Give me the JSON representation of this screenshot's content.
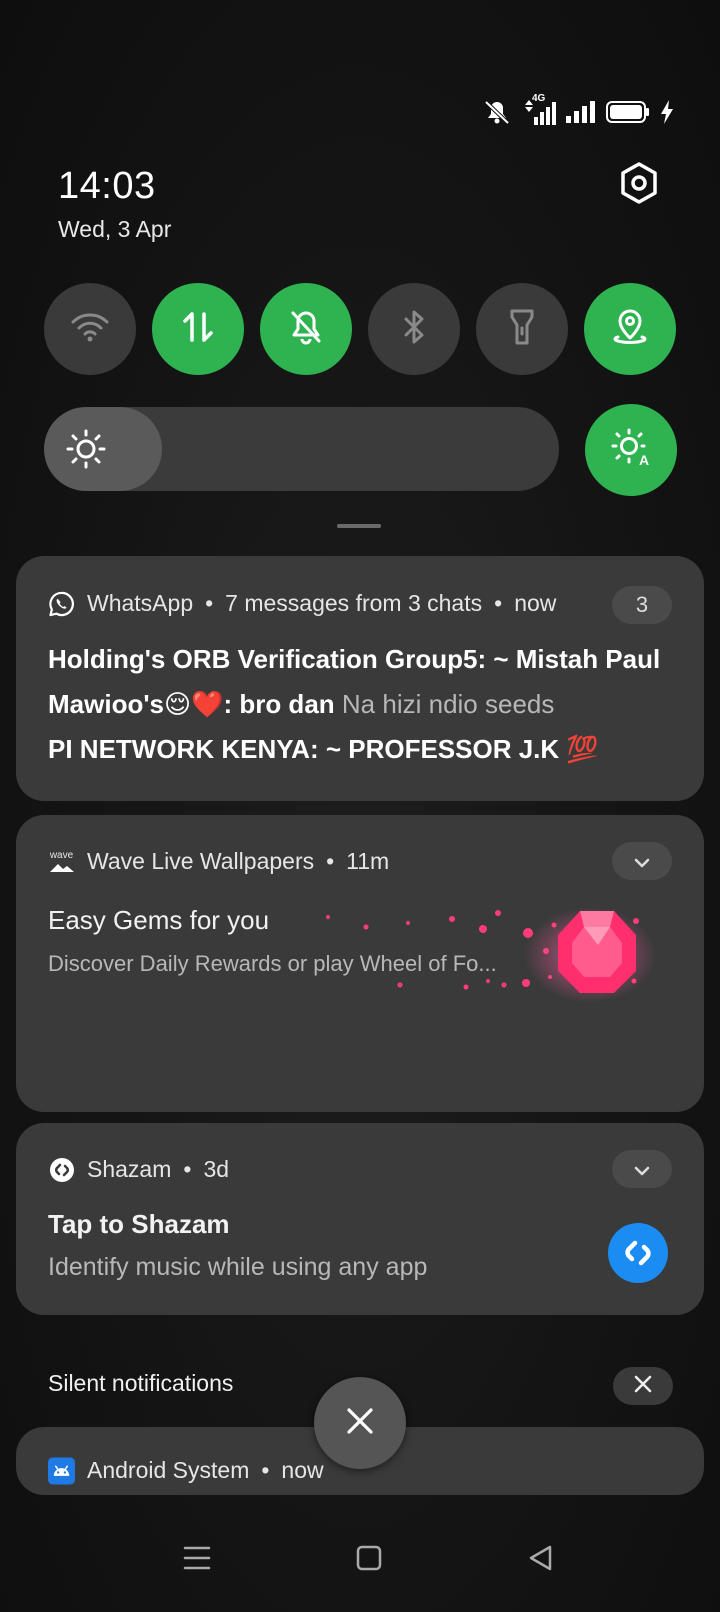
{
  "status_bar": {
    "network_label": "4G",
    "icons": [
      "mute-icon",
      "data-arrows-icon",
      "signal-icon",
      "signal-icon",
      "battery-icon",
      "charging-icon"
    ]
  },
  "header": {
    "time": "14:03",
    "date": "Wed, 3 Apr"
  },
  "quick_tiles": [
    {
      "name": "wifi",
      "state": "off"
    },
    {
      "name": "mobile-data",
      "state": "on"
    },
    {
      "name": "mute",
      "state": "on"
    },
    {
      "name": "bluetooth",
      "state": "off"
    },
    {
      "name": "flashlight",
      "state": "off"
    },
    {
      "name": "location",
      "state": "on"
    }
  ],
  "brightness": {
    "level": 0.23,
    "auto": true
  },
  "notifications": {
    "whatsapp": {
      "app": "WhatsApp",
      "sep1": "•",
      "summary": "7 messages from 3 chats",
      "sep2": "•",
      "time": "now",
      "count": "3",
      "lines": [
        {
          "sender": "Holding's ORB Verification Group5: ~ Mistah Paul",
          "text": ""
        },
        {
          "sender": "Mawioo's😌❤️: bro dan",
          "text": "Na hizi ndio seeds"
        },
        {
          "sender": "PI NETWORK KENYA: ~ PROFESSOR J.K",
          "text": "💯"
        }
      ]
    },
    "wave": {
      "icon_text": "wave",
      "app": "Wave Live Wallpapers",
      "sep": "•",
      "time": "11m",
      "title": "Easy Gems for you",
      "body": "Discover Daily Rewards or play Wheel of Fo..."
    },
    "shazam": {
      "app": "Shazam",
      "sep": "•",
      "time": "3d",
      "title": "Tap to Shazam",
      "body": "Identify music while using any app"
    },
    "silent_header": "Silent notifications",
    "android": {
      "app": "Android System",
      "sep": "•",
      "time": "now"
    }
  },
  "colors": {
    "accent_green": "#2fb351",
    "tile_off": "#3a3a3a",
    "card_bg": "#3a3a3a",
    "shazam_blue": "#1b8cf2",
    "android_blue": "#1f7ae6"
  }
}
